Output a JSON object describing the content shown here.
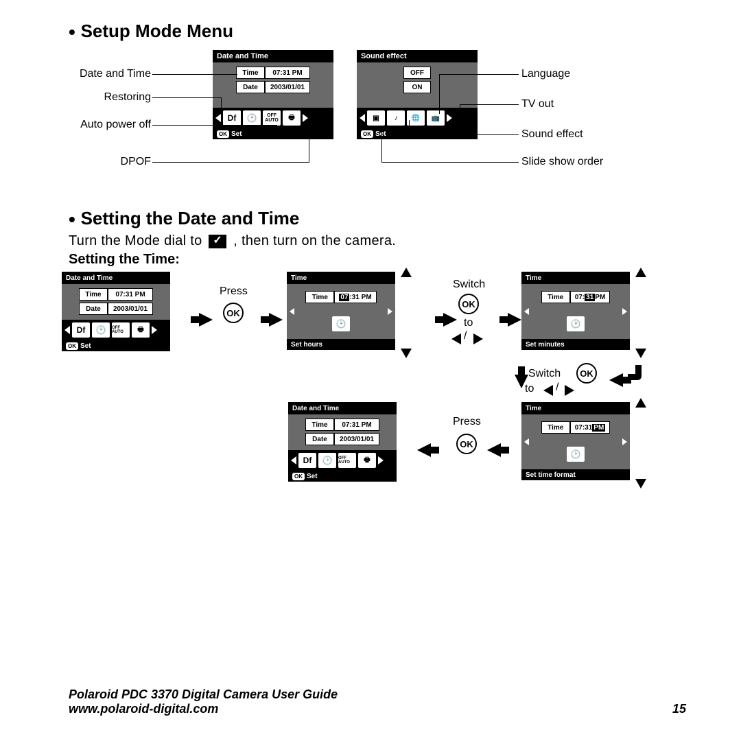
{
  "headings": {
    "setup": "Setup Mode Menu",
    "setting": "Setting the Date and Time",
    "settingTime": "Setting the Time:"
  },
  "instruction": {
    "pre": "Turn the Mode dial to ",
    "post": " , then turn on the camera."
  },
  "lcdSetup": {
    "dateTime": {
      "title": "Date and Time",
      "time_label": "Time",
      "time_val": "07:31 PM",
      "date_label": "Date",
      "date_val": "2003/01/01",
      "footer": "Set",
      "df": "Df",
      "offauto": "OFF AUTO"
    },
    "sound": {
      "title": "Sound effect",
      "off": "OFF",
      "on": "ON",
      "footer": "Set"
    }
  },
  "callouts": {
    "l1": "Date and Time",
    "l2": "Restoring",
    "l3": "Auto power off",
    "l4": "DPOF",
    "r1": "Language",
    "r2": "TV out",
    "r3": "Sound effect",
    "r4": "Slide show order"
  },
  "flow": {
    "screen1": {
      "title": "Date and Time",
      "time_label": "Time",
      "time_val": "07:31 PM",
      "date_label": "Date",
      "date_val": "2003/01/01",
      "footer": "Set",
      "df": "Df",
      "offauto": "OFF AUTO"
    },
    "press": "Press",
    "ok": "OK",
    "screen2": {
      "title": "Time",
      "time_label": "Time",
      "time_val": "07:31 PM",
      "highlight": "07",
      "footer": "Set hours"
    },
    "switch": "Switch",
    "to": "to",
    "screen3": {
      "title": "Time",
      "time_label": "Time",
      "time_val": "07:31 PM",
      "highlight": "31",
      "footer": "Set minutes"
    },
    "screen4": {
      "title": "Time",
      "time_label": "Time",
      "time_val": "07:31 PM",
      "highlight": "PM",
      "footer": "Set time format"
    },
    "screen5": {
      "title": "Date and Time",
      "time_label": "Time",
      "time_val": "07:31 PM",
      "date_label": "Date",
      "date_val": "2003/01/01",
      "footer": "Set",
      "df": "Df",
      "offauto": "OFF AUTO"
    }
  },
  "footer": {
    "line1": "Polaroid PDC 3370 Digital Camera User Guide",
    "line2": "www.polaroid-digital.com",
    "page": "15"
  }
}
